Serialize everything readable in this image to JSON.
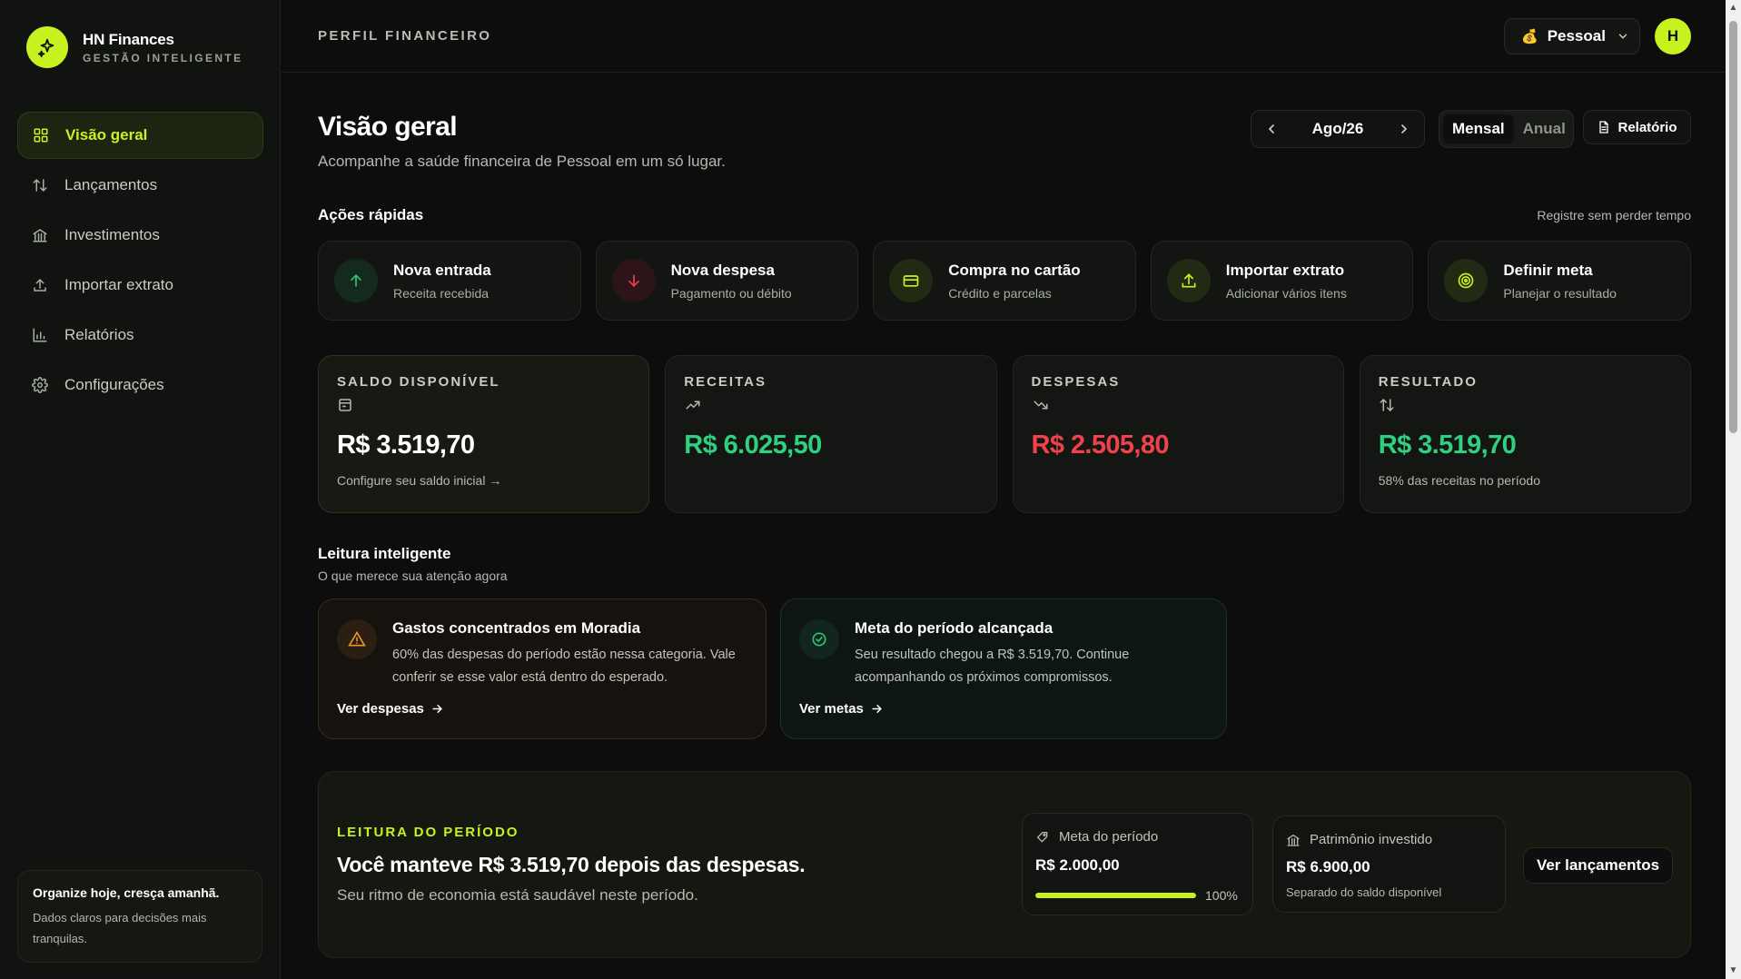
{
  "brand": {
    "title": "HN Finances",
    "subtitle": "GESTÃO INTELIGENTE"
  },
  "sidebar": {
    "items": [
      {
        "label": "Visão geral",
        "icon": "grid-icon",
        "active": true
      },
      {
        "label": "Lançamentos",
        "icon": "arrows-up-down-icon"
      },
      {
        "label": "Investimentos",
        "icon": "bank-icon"
      },
      {
        "label": "Importar extrato",
        "icon": "upload-icon"
      },
      {
        "label": "Relatórios",
        "icon": "bar-chart-icon"
      },
      {
        "label": "Configurações",
        "icon": "gear-icon"
      }
    ],
    "promo": {
      "title": "Organize hoje, cresça amanhã.",
      "text": "Dados claros para decisões mais tranquilas."
    }
  },
  "topbar": {
    "title": "PERFIL FINANCEIRO",
    "profile": {
      "emoji": "💰",
      "label": "Pessoal"
    },
    "avatar": "H"
  },
  "header": {
    "title": "Visão geral",
    "subtitle": "Acompanhe a saúde financeira de Pessoal em um só lugar.",
    "period": "Ago/26",
    "view_options": [
      "Mensal",
      "Anual"
    ],
    "view_selected": "Mensal",
    "report_label": "Relatório"
  },
  "quick_actions": {
    "title": "Ações rápidas",
    "aside": "Registre sem perder tempo",
    "items": [
      {
        "title": "Nova entrada",
        "sub": "Receita recebida",
        "icon": "arrow-up-icon",
        "color": "#2fc47a"
      },
      {
        "title": "Nova despesa",
        "sub": "Pagamento ou débito",
        "icon": "arrow-down-icon",
        "color": "#ef3f4a"
      },
      {
        "title": "Compra no cartão",
        "sub": "Crédito e parcelas",
        "icon": "credit-card-icon",
        "color": "#c8f21f"
      },
      {
        "title": "Importar extrato",
        "sub": "Adicionar vários itens",
        "icon": "upload-icon",
        "color": "#c8f21f"
      },
      {
        "title": "Definir meta",
        "sub": "Planejar o resultado",
        "icon": "target-icon",
        "color": "#c8f21f"
      }
    ]
  },
  "summary": [
    {
      "label": "SALDO DISPONÍVEL",
      "icon": "wallet-icon",
      "value": "R$ 3.519,70",
      "note": "Configure seu saldo inicial →",
      "color": "#ffffff"
    },
    {
      "label": "RECEITAS",
      "icon": "trend-up-icon",
      "value": "R$ 6.025,50",
      "note": "",
      "color": "#2fd080"
    },
    {
      "label": "DESPESAS",
      "icon": "trend-down-icon",
      "value": "R$ 2.505,80",
      "note": "",
      "color": "#f0424c"
    },
    {
      "label": "RESULTADO",
      "icon": "arrows-up-down-icon",
      "value": "R$ 3.519,70",
      "note": "58% das receitas no período",
      "color": "#2fd080"
    }
  ],
  "insights": {
    "title": "Leitura inteligente",
    "subtitle": "O que merece sua atenção agora",
    "items": [
      {
        "title": "Gastos concentrados em Moradia",
        "text": "60% das despesas do período estão nessa categoria. Vale conferir se esse valor está dentro do esperado.",
        "link": "Ver despesas",
        "icon": "warning-icon"
      },
      {
        "title": "Meta do período alcançada",
        "text": "Seu resultado chegou a R$ 3.519,70. Continue acompanhando os próximos compromissos.",
        "link": "Ver metas",
        "icon": "check-circle-icon"
      }
    ]
  },
  "period_panel": {
    "kicker": "LEITURA DO PERÍODO",
    "title": "Você manteve R$ 3.519,70 depois das despesas.",
    "subtitle": "Seu ritmo de economia está saudável neste período.",
    "goal": {
      "label": "Meta do período",
      "value": "R$ 2.000,00",
      "progress": 100,
      "progress_label": "100%"
    },
    "assets": {
      "label": "Patrimônio investido",
      "value": "R$ 6.900,00",
      "note": "Separado do saldo disponível"
    },
    "button": "Ver lançamentos"
  }
}
